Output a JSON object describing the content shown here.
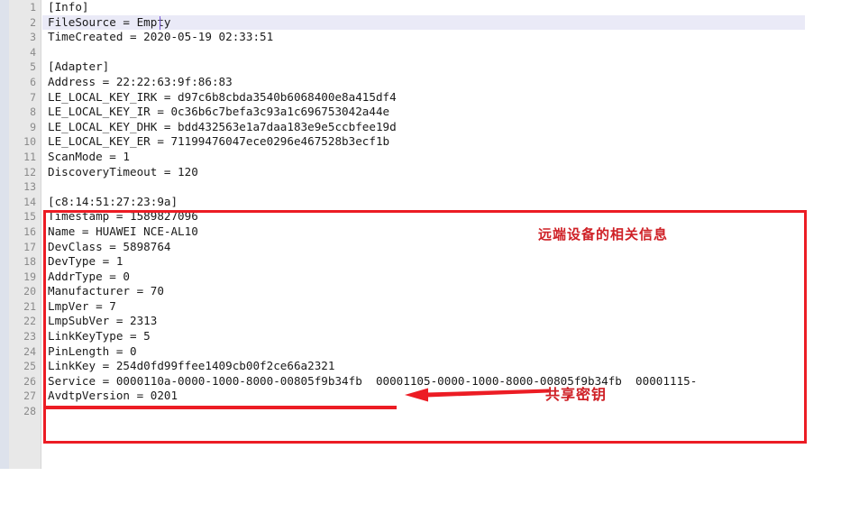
{
  "editor": {
    "type": "text-editor",
    "file_kind": "bluetooth-config-ini",
    "gutter": {
      "line_numbers": [
        "1",
        "2",
        "3",
        "4",
        "5",
        "6",
        "7",
        "8",
        "9",
        "10",
        "11",
        "12",
        "13",
        "14",
        "15",
        "16",
        "17",
        "18",
        "19",
        "20",
        "21",
        "22",
        "23",
        "24",
        "25",
        "26",
        "27",
        "28"
      ]
    },
    "active_line": 2,
    "caret_after_text": "FileSource = E",
    "lines": [
      "[Info]",
      "FileSource = Empty",
      "TimeCreated = 2020-05-19 02:33:51",
      "",
      "[Adapter]",
      "Address = 22:22:63:9f:86:83",
      "LE_LOCAL_KEY_IRK = d97c6b8cbda3540b6068400e8a415df4",
      "LE_LOCAL_KEY_IR = 0c36b6c7befa3c93a1c696753042a44e",
      "LE_LOCAL_KEY_DHK = bdd432563e1a7daa183e9e5ccbfee19d",
      "LE_LOCAL_KEY_ER = 71199476047ece0296e467528b3ecf1b",
      "ScanMode = 1",
      "DiscoveryTimeout = 120",
      "",
      "[c8:14:51:27:23:9a]",
      "Timestamp = 1589827096",
      "Name = HUAWEI NCE-AL10",
      "DevClass = 5898764",
      "DevType = 1",
      "AddrType = 0",
      "Manufacturer = 70",
      "LmpVer = 7",
      "LmpSubVer = 2313",
      "LinkKeyType = 5",
      "PinLength = 0",
      "LinkKey = 254d0fd99ffee1409cb00f2ce66a2321",
      "Service = 0000110a-0000-1000-8000-00805f9b34fb  00001105-0000-1000-8000-00805f9b34fb  00001115-",
      "AvdtpVersion = 0201",
      ""
    ]
  },
  "annotations": {
    "remote_device_label": "远端设备的相关信息",
    "shared_key_label": "共享密钥",
    "box_color": "#ec1c24",
    "label_color": "#cf2026",
    "arrow_direction": "left",
    "arrow_points_to_line": 25,
    "box_covers_lines": "14-27"
  },
  "colors": {
    "gutter_bg": "#e8e8e8",
    "gutter_text": "#8a8a8a",
    "code_text": "#1a1a1a",
    "active_line_bg": "#eaeaf7",
    "caret": "#7a5ad6",
    "left_strip": "#dde2ec",
    "editor_bg": "#ffffff"
  }
}
